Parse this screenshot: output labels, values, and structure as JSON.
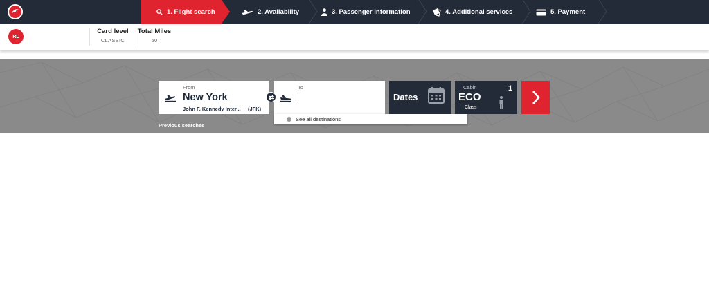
{
  "header": {
    "steps": [
      {
        "label": "1. Flight search",
        "icon": "search-icon",
        "active": true
      },
      {
        "label": "2. Availability",
        "icon": "plane-icon",
        "active": false
      },
      {
        "label": "3. Passenger information",
        "icon": "person-icon",
        "active": false
      },
      {
        "label": "4. Additional services",
        "icon": "ticket-icon",
        "active": false
      },
      {
        "label": "5. Payment",
        "icon": "card-icon",
        "active": false
      }
    ]
  },
  "user": {
    "initials": "RL",
    "card_level_label": "Card level",
    "card_level_value": "CLASSIC",
    "miles_label": "Total Miles",
    "miles_value": "50"
  },
  "search": {
    "from": {
      "label": "From",
      "city": "New York",
      "airport": "John F. Kennedy Inter...",
      "code": "(JFK)"
    },
    "to": {
      "label": "To",
      "value": ""
    },
    "destinations_link": "See all destinations",
    "dates_label": "Dates",
    "cabin": {
      "label": "Cabin",
      "value": "ECO",
      "sub": "Class",
      "passengers": "1"
    },
    "previous_searches": "Previous searches"
  },
  "colors": {
    "brand_red": "#e0242f",
    "navy": "#232b38",
    "band_gray": "#8a8a8a"
  }
}
